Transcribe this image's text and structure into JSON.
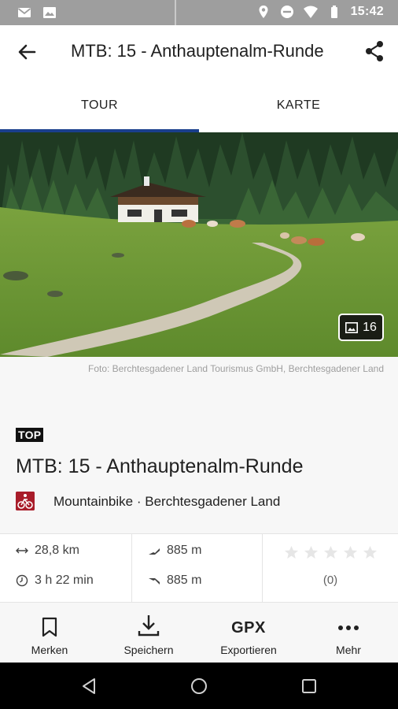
{
  "status_bar": {
    "time": "15:42",
    "left_icons": [
      "gmail-icon",
      "image-icon"
    ],
    "right_icons": [
      "location-icon",
      "do-not-disturb-icon",
      "wifi-icon",
      "battery-icon"
    ]
  },
  "app_bar": {
    "title": "MTB: 15 - Anthauptenalm-Runde",
    "back_icon": "arrow-back-icon",
    "share_icon": "share-icon"
  },
  "tabs": [
    {
      "label": "TOUR",
      "selected": true
    },
    {
      "label": "KARTE",
      "selected": false
    }
  ],
  "hero": {
    "photo_count": "16",
    "caption": "Foto: Berchtesgadener Land Tourismus GmbH, Berchtesgadener Land"
  },
  "tour": {
    "badge": "TOP",
    "title": "MTB: 15 - Anthauptenalm-Runde",
    "category": "Mountainbike",
    "separator": "·",
    "region": "Berchtesgadener Land"
  },
  "stats": {
    "distance": "28,8 km",
    "duration": "3 h 22 min",
    "ascent": "885 m",
    "descent": "885 m",
    "rating_stars": 0,
    "rating_count": "(0)"
  },
  "actions": [
    {
      "label": "Merken",
      "icon": "bookmark-icon"
    },
    {
      "label": "Speichern",
      "icon": "download-icon"
    },
    {
      "label": "Exportieren",
      "icon_text": "GPX"
    },
    {
      "label": "Mehr",
      "icon": "more-horizontal-icon"
    }
  ],
  "colors": {
    "tab_indicator": "#1a3f8c",
    "category_icon": "#a91d2a",
    "status_bar": "#9e9e9e"
  }
}
